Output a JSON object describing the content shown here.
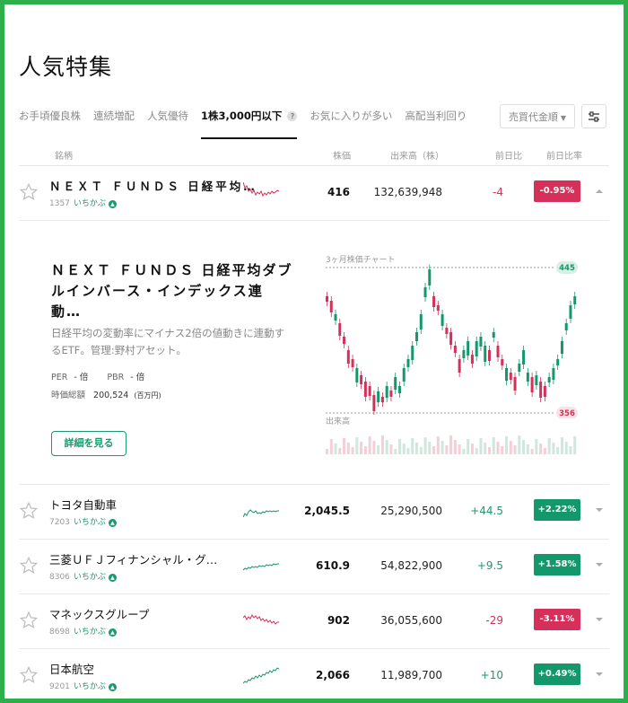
{
  "page_title": "人気特集",
  "tabs": [
    {
      "label": "お手頃優良株"
    },
    {
      "label": "連続増配"
    },
    {
      "label": "人気優待"
    },
    {
      "label": "1株3,000円以下"
    },
    {
      "label": "お気に入りが多い"
    },
    {
      "label": "高配当利回り"
    }
  ],
  "help_icon_text": "?",
  "sort": {
    "label": "売買代金順"
  },
  "columns": {
    "name": "銘柄",
    "price": "株価",
    "volume": "出来高（株）",
    "change": "前日比",
    "change_pct": "前日比率"
  },
  "ichikabu_label": "いちかぶ",
  "rows": [
    {
      "name": "ＮＥＸＴ ＦＵＮＤＳ 日経平均…",
      "code": "1357",
      "price": "416",
      "volume": "132,639,948",
      "change": "-4",
      "change_pct": "-0.95%",
      "direction": "neg",
      "expanded": true
    },
    {
      "name": "トヨタ自動車",
      "code": "7203",
      "price": "2,045.5",
      "volume": "25,290,500",
      "change": "+44.5",
      "change_pct": "+2.22%",
      "direction": "pos"
    },
    {
      "name": "三菱ＵＦＪフィナンシャル・グ…",
      "code": "8306",
      "price": "610.9",
      "volume": "54,822,900",
      "change": "+9.5",
      "change_pct": "+1.58%",
      "direction": "pos"
    },
    {
      "name": "マネックスグループ",
      "code": "8698",
      "price": "902",
      "volume": "36,055,600",
      "change": "-29",
      "change_pct": "-3.11%",
      "direction": "neg"
    },
    {
      "name": "日本航空",
      "code": "9201",
      "price": "2,066",
      "volume": "11,989,700",
      "change": "+10",
      "change_pct": "+0.49%",
      "direction": "pos"
    }
  ],
  "detail": {
    "title": "ＮＥＸＴ ＦＵＮＤＳ 日経平均ダブルインバース・インデックス連動…",
    "dash": "-",
    "description": "日経平均の変動率にマイナス2倍の値動きに連動するETF。管理:野村アセット。",
    "per_label": "PER",
    "per_value": "- 倍",
    "pbr_label": "PBR",
    "pbr_value": "- 倍",
    "market_cap_label": "時価総額",
    "market_cap_value": "200,524",
    "market_cap_unit": "(百万円)",
    "button_label": "詳細を見る",
    "chart_title": "3ヶ月株価チャート",
    "volume_title": "出来高",
    "chart_high": "445",
    "chart_low": "356"
  },
  "colors": {
    "up": "#15976c",
    "down": "#d4305a",
    "frame": "#2db04b"
  }
}
